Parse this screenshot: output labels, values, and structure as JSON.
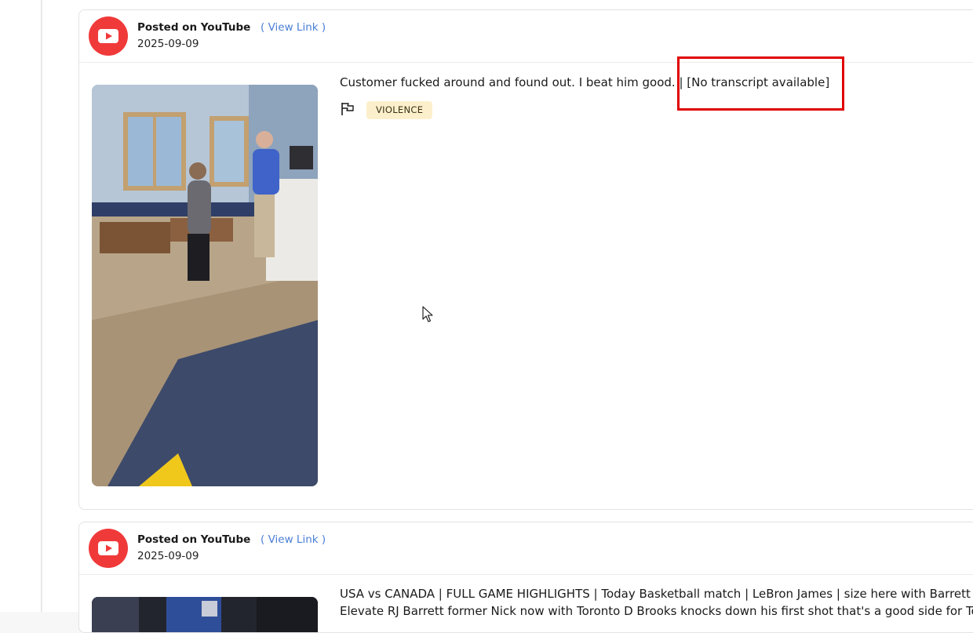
{
  "posts": [
    {
      "posted_on": "Posted on YouTube",
      "view_link": "( View Link )",
      "date": "2025-09-09",
      "caption": "Customer fucked around and found out. I beat him good. | [No transcript available]",
      "tag": "VIOLENCE"
    },
    {
      "posted_on": "Posted on YouTube",
      "view_link": "( View Link )",
      "date": "2025-09-09",
      "caption": "USA vs CANADA | FULL GAME HIGHLIGHTS | Today Basketball match | LeBron James | size here with Barrett",
      "caption_line2": "Elevate RJ Barrett former Nick now with Toronto D Brooks knocks down his first shot that's a good side for To"
    }
  ],
  "colors": {
    "youtube_red": "#f03a3a",
    "link_blue": "#4a7fd6",
    "tag_bg": "#fcf0cc",
    "highlight_red": "#e00000"
  },
  "icons": [
    "youtube-icon",
    "flag-icon",
    "mouse-cursor-icon"
  ]
}
